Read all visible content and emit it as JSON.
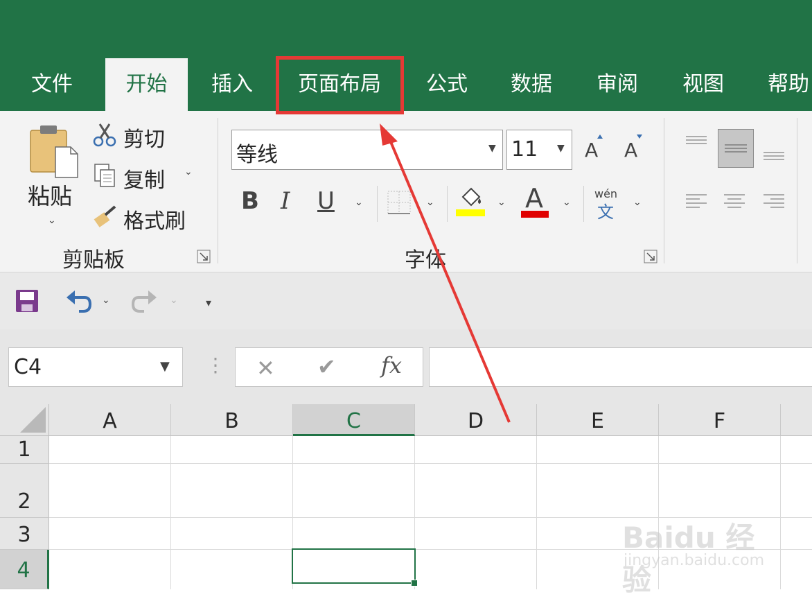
{
  "tabs": [
    "文件",
    "开始",
    "插入",
    "页面布局",
    "公式",
    "数据",
    "审阅",
    "视图",
    "帮助"
  ],
  "colors": {
    "brand": "#217346",
    "highlight_box": "#e53935",
    "fill_yellow": "#ffff00",
    "font_red": "#e00000"
  },
  "clipboard": {
    "paste_label": "粘贴",
    "cut_label": "剪切",
    "copy_label": "复制",
    "format_painter_label": "格式刷",
    "group_label": "剪贴板"
  },
  "font": {
    "font_name": "等线",
    "font_size": "11",
    "group_label": "字体",
    "bold": "B",
    "italic": "I",
    "underline": "U",
    "font_color_glyph": "A",
    "phonetic_top": "wén",
    "phonetic_bottom": "文"
  },
  "formula_bar": {
    "name_box": "C4",
    "fx_label": "fx",
    "formula_value": ""
  },
  "grid": {
    "columns": [
      "A",
      "B",
      "C",
      "D",
      "E",
      "F"
    ],
    "rows": [
      "1",
      "2",
      "3",
      "4"
    ],
    "active_cell": "C4"
  },
  "watermark": {
    "brand": "Baidu 经验",
    "url": "jingyan.baidu.com"
  }
}
